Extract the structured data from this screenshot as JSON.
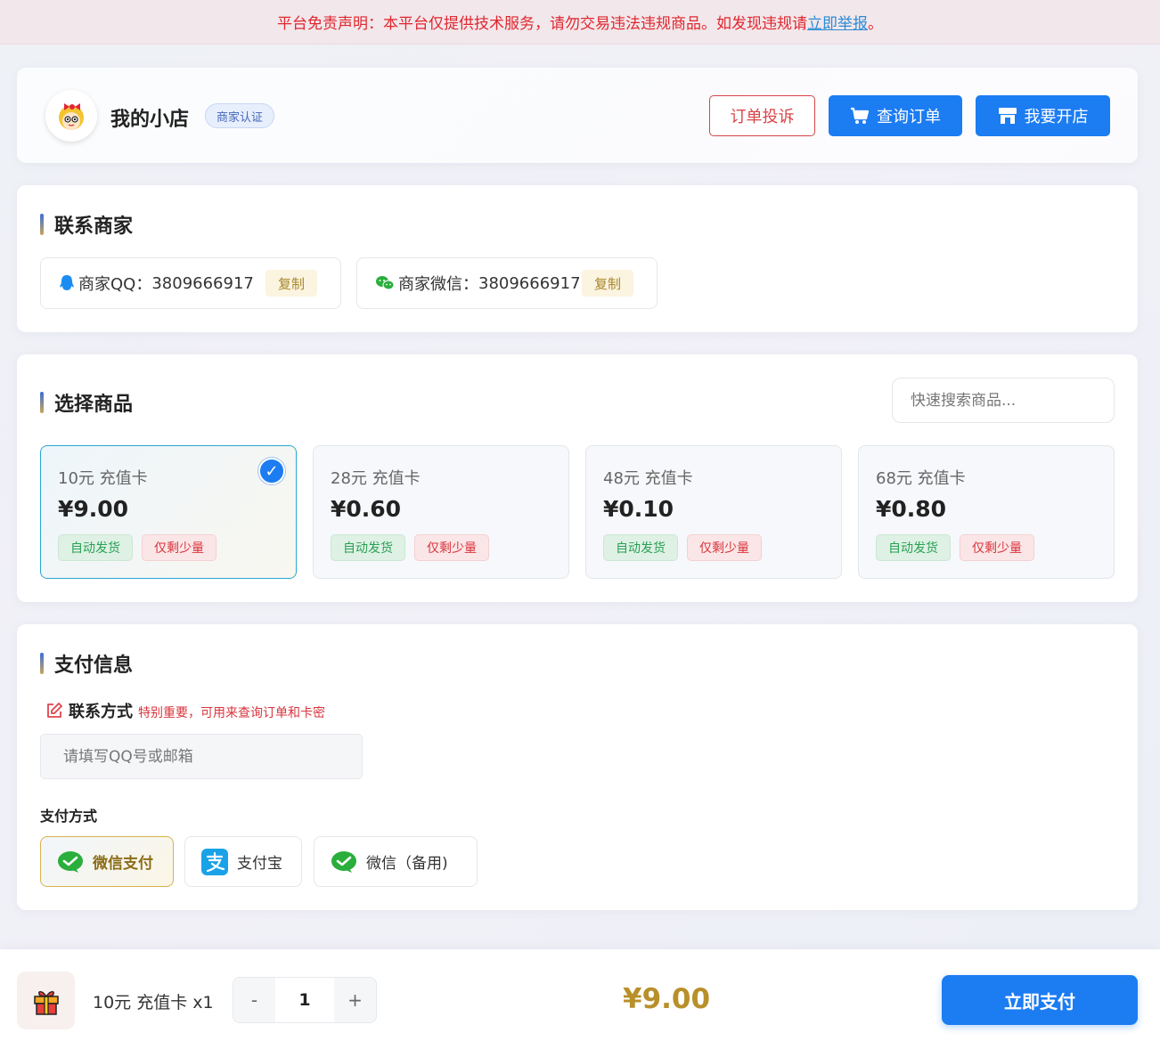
{
  "notice": {
    "text": "平台免责声明：本平台仅提供技术服务，请勿交易违法违规商品。如发现违规请",
    "link": "立即举报",
    "suffix": "。"
  },
  "header": {
    "shop_name": "我的小店",
    "badge": "商家认证",
    "btn_complain": "订单投诉",
    "btn_query": "查询订单",
    "btn_open": "我要开店"
  },
  "contact": {
    "title": "联系商家",
    "qq_label": "商家QQ：",
    "qq_value": "3809666917",
    "wechat_label": "商家微信：",
    "wechat_value": "3809666917",
    "copy": "复制"
  },
  "products": {
    "title": "选择商品",
    "search_placeholder": "快速搜索商品...",
    "items": [
      {
        "name": "10元 充值卡",
        "price": "¥9.00",
        "tag1": "自动发货",
        "tag2": "仅剩少量",
        "selected": true
      },
      {
        "name": "28元 充值卡",
        "price": "¥0.60",
        "tag1": "自动发货",
        "tag2": "仅剩少量",
        "selected": false
      },
      {
        "name": "48元 充值卡",
        "price": "¥0.10",
        "tag1": "自动发货",
        "tag2": "仅剩少量",
        "selected": false
      },
      {
        "name": "68元 充值卡",
        "price": "¥0.80",
        "tag1": "自动发货",
        "tag2": "仅剩少量",
        "selected": false
      }
    ],
    "check_mark": "✓"
  },
  "payment": {
    "title": "支付信息",
    "contact_label": "联系方式",
    "contact_hint": "特别重要，可用来查询订单和卡密",
    "contact_placeholder": "请填写QQ号或邮箱",
    "method_label": "支付方式",
    "methods": [
      {
        "label": "微信支付",
        "icon": "wechat-pay-icon",
        "active": true
      },
      {
        "label": "支付宝",
        "icon": "alipay-icon",
        "active": false
      },
      {
        "label": "微信（备用)",
        "icon": "wechat-pay-icon",
        "active": false
      }
    ]
  },
  "bottom": {
    "summary": "10元 充值卡 x1",
    "minus": "-",
    "quantity": "1",
    "plus": "+",
    "total": "¥9.00",
    "pay_now": "立即支付"
  },
  "colors": {
    "primary": "#1c7cf2",
    "danger": "#d8454a",
    "gold": "#b8902a"
  }
}
